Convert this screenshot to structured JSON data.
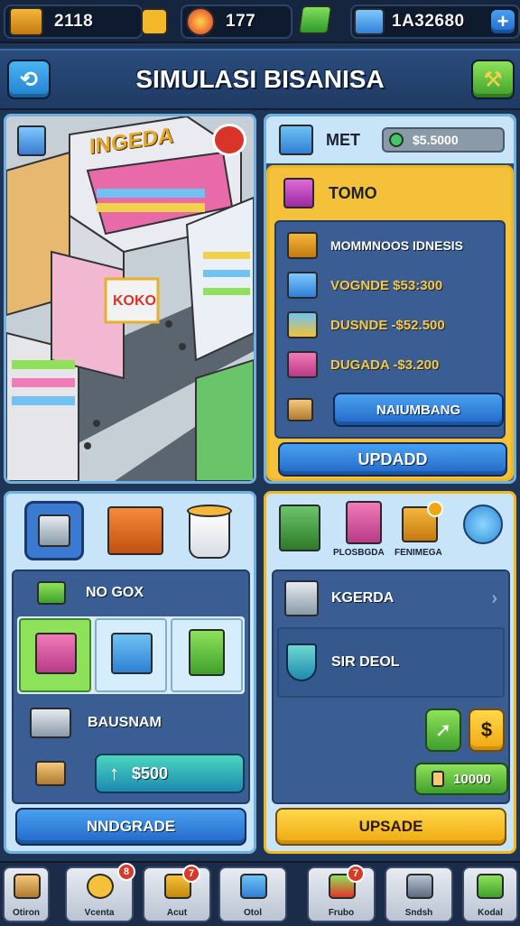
{
  "resources": {
    "coins": "2118",
    "gems": "177",
    "cash": "1A32680",
    "plus_label": "+"
  },
  "header": {
    "title": "SIMULASI BISANISA",
    "back_label": "⟲",
    "build_label": "⚒"
  },
  "scene": {
    "store_sign": "INGEDA",
    "shelf_sign": "KOKO"
  },
  "market_panel": {
    "tab_label": "MET",
    "balance": "$5.5000",
    "section_title": "TOMO",
    "items": [
      {
        "label": "MOMMNOOS IDNESIS"
      },
      {
        "label": "VOGNDE $53:300"
      },
      {
        "label": "DUSNDE -$52.500"
      },
      {
        "label": "DUGADA -$3.200"
      }
    ],
    "sub_button": "NAIUMBANG",
    "update_button": "UPDADD"
  },
  "inventory_panel": {
    "row1_label": "NO GOX",
    "row2_label": "BAUSNAM",
    "price_button": "$500",
    "upgrade_button": "NNDGRADE"
  },
  "staff_panel": {
    "icon_labels": [
      "PLOSBGDA",
      "FENIMEGA"
    ],
    "row1_label": "KGERDA",
    "row2_label": "SIR DEOL",
    "amount_button": "10000",
    "upgrade_button": "UPSADE"
  },
  "nav": {
    "items": [
      {
        "label": "Otiron",
        "badge": ""
      },
      {
        "label": "Vcenta",
        "badge": "8"
      },
      {
        "label": "Acut",
        "badge": "7"
      },
      {
        "label": "Otol",
        "badge": ""
      },
      {
        "label": "Frubo",
        "badge": "7"
      },
      {
        "label": "Sndsh",
        "badge": ""
      },
      {
        "label": "Kodal",
        "badge": ""
      }
    ]
  },
  "colors": {
    "accent_blue": "#2f86e0",
    "accent_gold": "#f0b81e",
    "panel_border_blue": "#6fb0e0",
    "background": "#1f3556"
  }
}
